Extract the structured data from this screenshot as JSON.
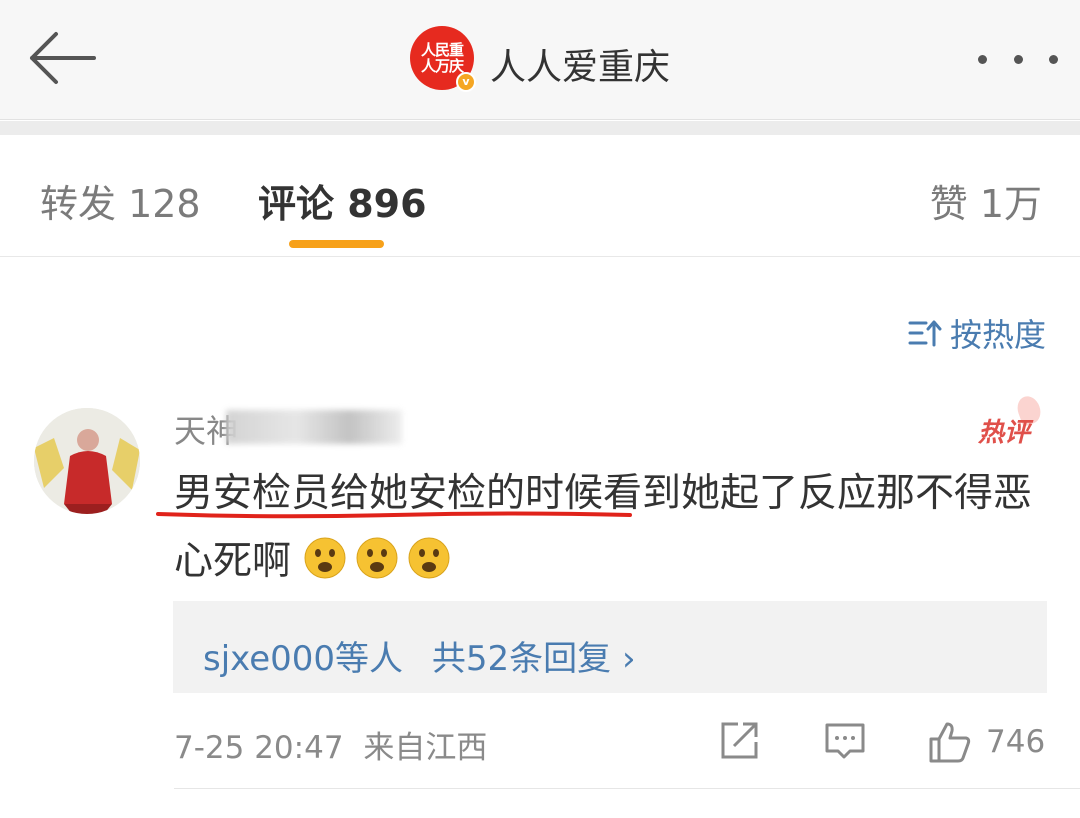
{
  "header": {
    "back_icon": "arrow-left-icon",
    "logo_text_line1": "人民重",
    "logo_text_line2": "人万庆",
    "verified_badge": "v",
    "title": "人人爱重庆",
    "more_icon": "more-dots-icon"
  },
  "tabs": [
    {
      "label": "转发 128",
      "active": false
    },
    {
      "label": "评论 896",
      "active": true
    },
    {
      "label": "赞 1万",
      "active": false
    }
  ],
  "colors": {
    "accent": "#f7a11a",
    "link": "#4a7cb0",
    "hot": "#e0504a",
    "underline_mark": "#e0231b",
    "logo_bg": "#e62a1f"
  },
  "sort": {
    "label": "按热度",
    "icon": "sort-icon"
  },
  "comment": {
    "username_visible": "天神",
    "hot_label": "热评",
    "text": "男安检员给她安检的时候看到她起了反应那不得恶心死啊",
    "emojis": [
      "frown-emoji",
      "frown-emoji",
      "frown-emoji"
    ],
    "replies": {
      "users": "sjxe000等人",
      "count_text": "共52条回复",
      "chevron": "›"
    },
    "timestamp": "7-25 20:47",
    "location": "来自江西",
    "like_count": "746"
  }
}
